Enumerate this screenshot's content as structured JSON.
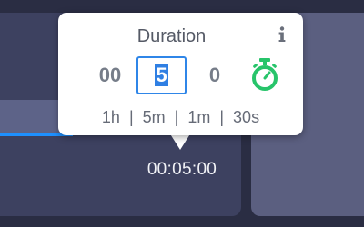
{
  "popup": {
    "title": "Duration",
    "info_icon": "info-icon",
    "hours": "00",
    "minutes": "5",
    "seconds": "0",
    "timer_icon": "stopwatch-icon",
    "presets": [
      "1h",
      "5m",
      "1m",
      "30s"
    ],
    "separator": "|"
  },
  "timeline": {
    "time_label": "00:05:00"
  },
  "colors": {
    "accent_blue": "#2f86e8",
    "timer_green": "#27c46a",
    "background": "#2a2d43"
  }
}
